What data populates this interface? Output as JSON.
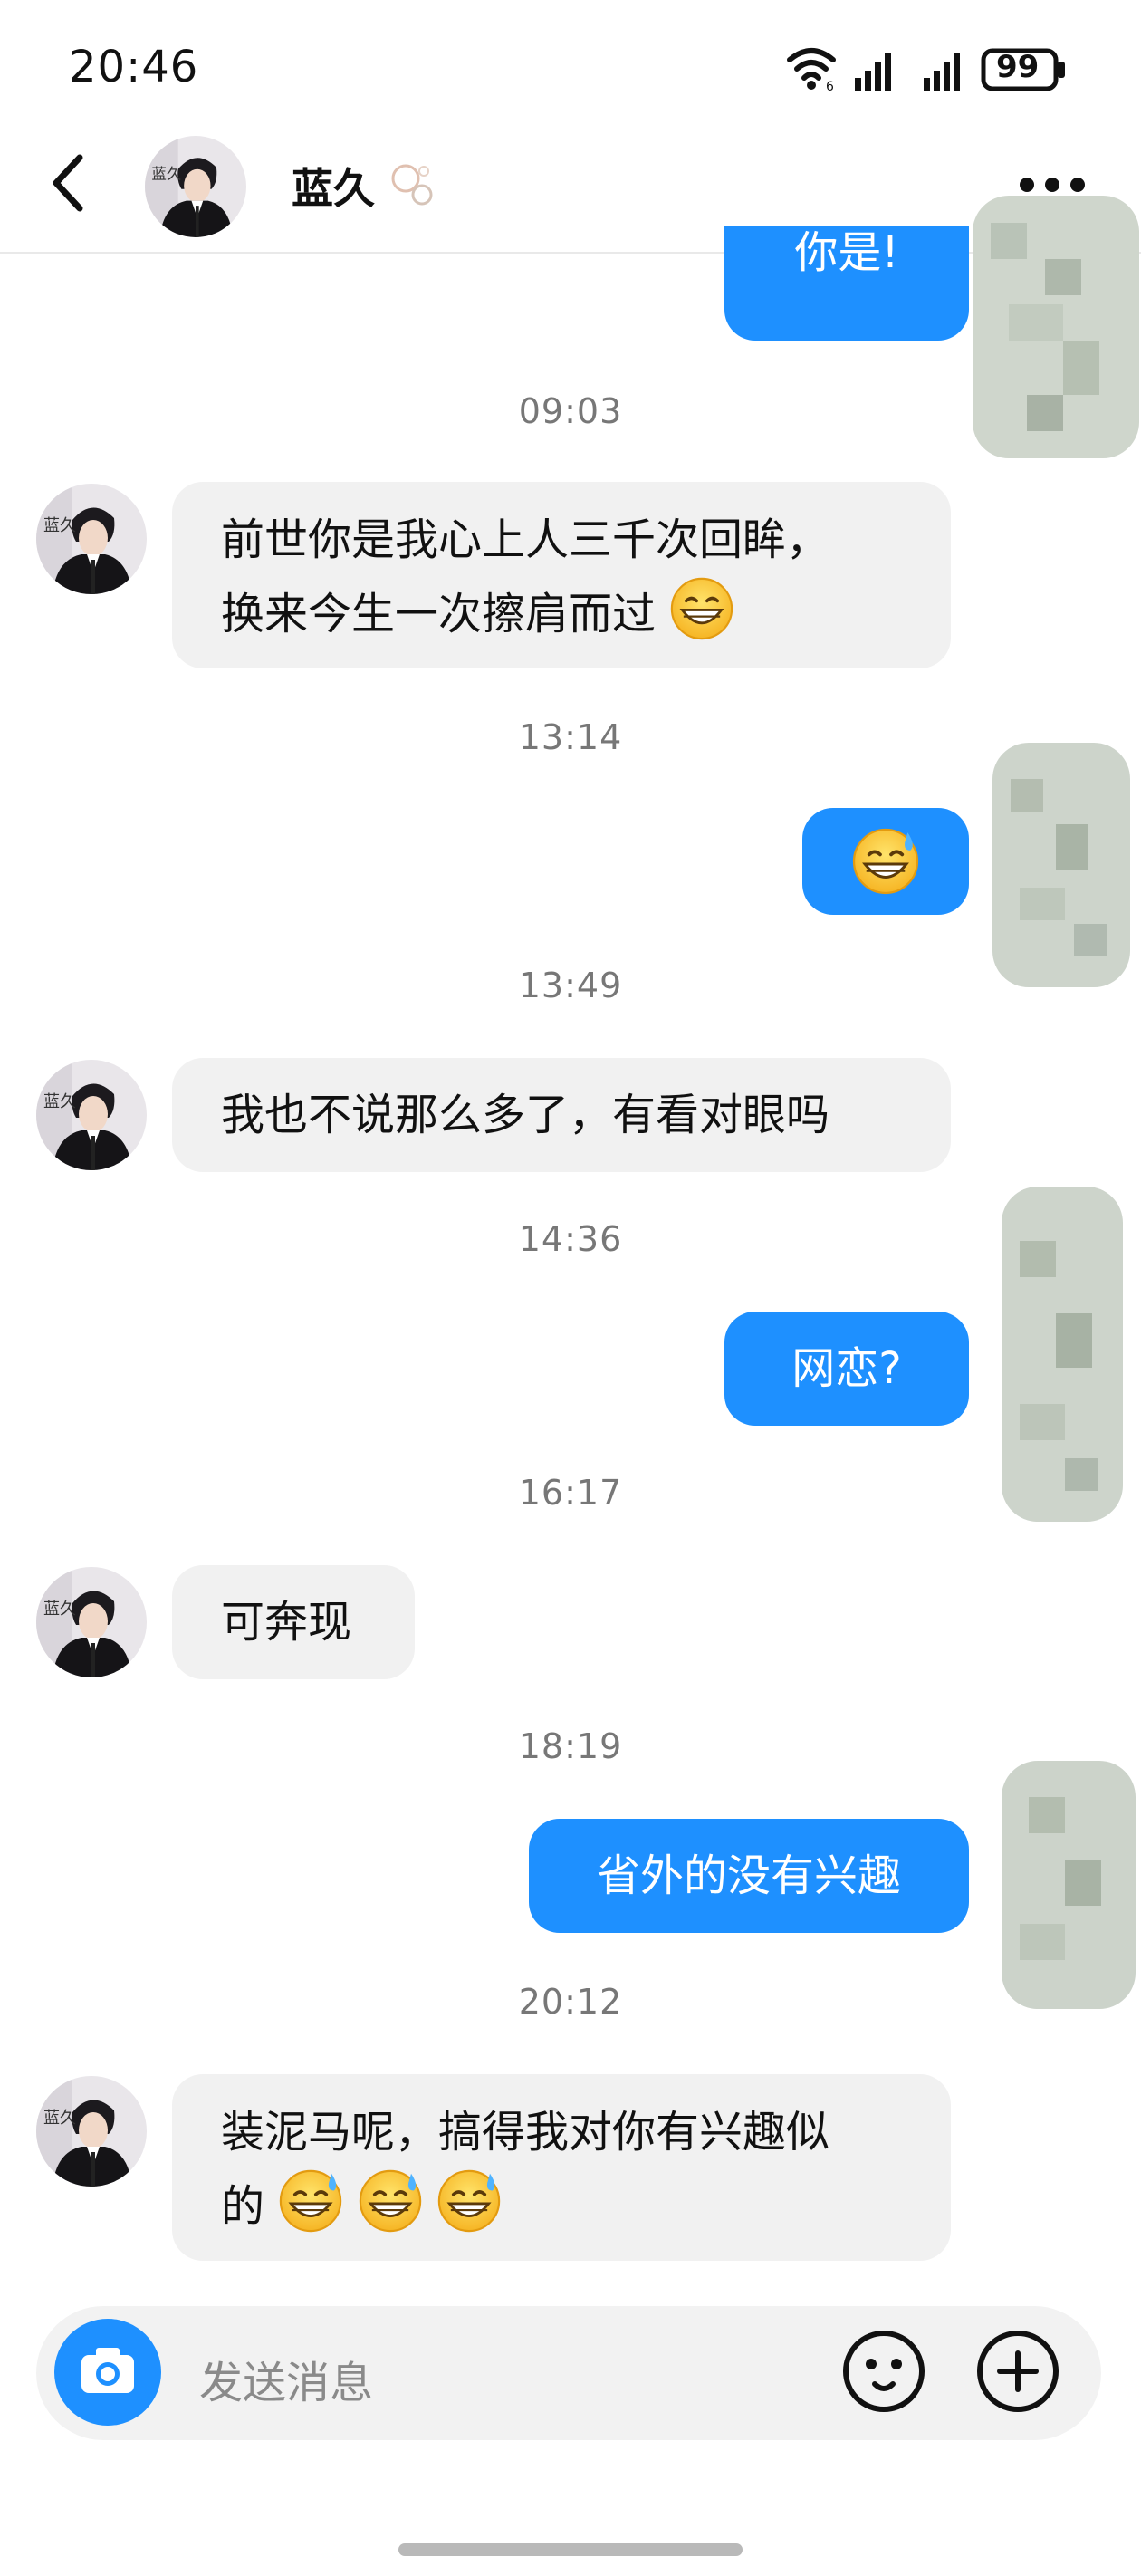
{
  "status_bar": {
    "time": "20:46",
    "battery": "99"
  },
  "header": {
    "contact_name": "蓝久"
  },
  "messages": [
    {
      "side": "out",
      "text": "你是!"
    },
    {
      "type": "time",
      "text": "09:03"
    },
    {
      "side": "in",
      "lines": [
        "前世你是我心上人三千次回眸，",
        "换来今生一次擦肩而过"
      ]
    },
    {
      "type": "time",
      "text": "13:14"
    },
    {
      "side": "out",
      "text": ""
    },
    {
      "type": "time",
      "text": "13:49"
    },
    {
      "side": "in",
      "text": "我也不说那么多了，有看对眼吗"
    },
    {
      "type": "time",
      "text": "14:36"
    },
    {
      "side": "out",
      "text": "网恋?"
    },
    {
      "type": "time",
      "text": "16:17"
    },
    {
      "side": "in",
      "text": "可奔现"
    },
    {
      "type": "time",
      "text": "18:19"
    },
    {
      "side": "out",
      "text": "省外的没有兴趣"
    },
    {
      "type": "time",
      "text": "20:12"
    },
    {
      "side": "in",
      "lines": [
        "装泥马呢，搞得我对你有兴趣似",
        "的"
      ]
    }
  ],
  "input": {
    "placeholder": "发送消息"
  },
  "colors": {
    "accent": "#1e90ff",
    "bubble_in": "#f1f1f1"
  },
  "icons": {
    "back": "chevron-left-icon",
    "more": "more-dots-icon",
    "camera": "camera-icon",
    "emoji": "smiley-icon",
    "plus": "plus-circle-icon"
  }
}
